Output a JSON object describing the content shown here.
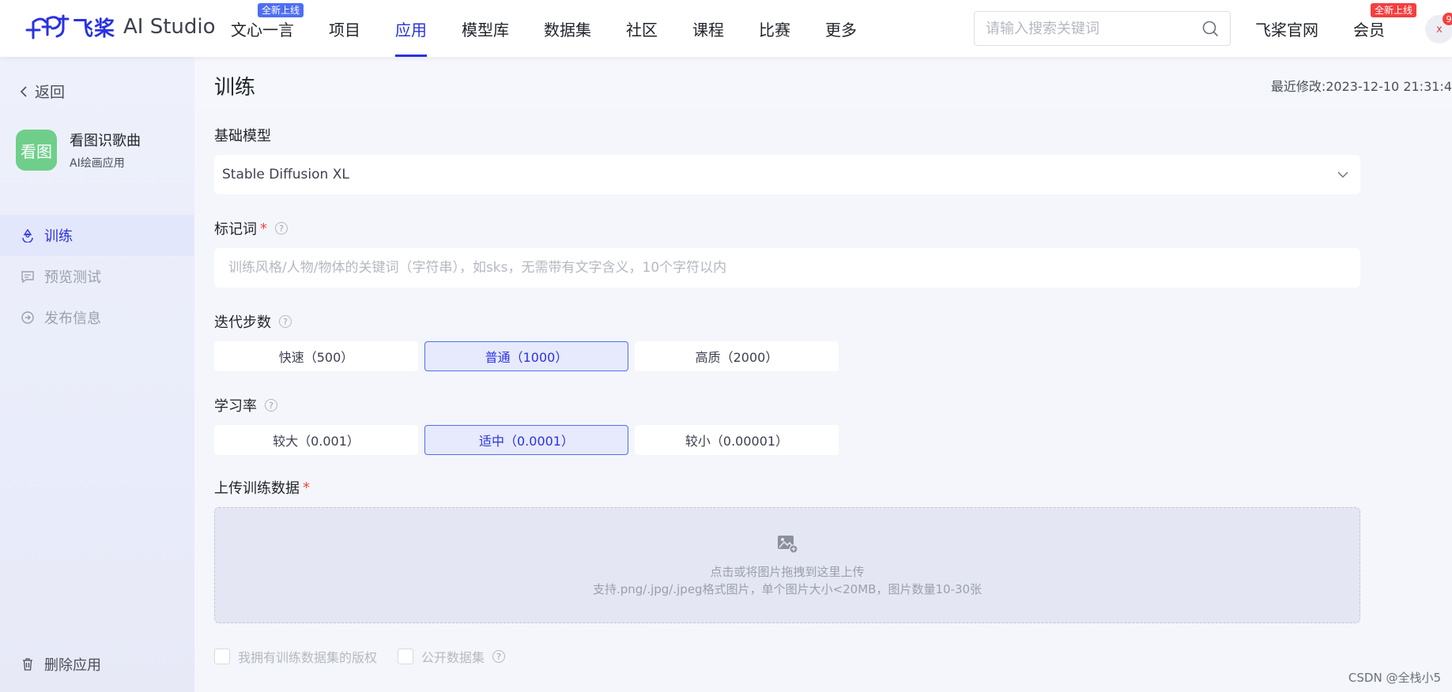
{
  "nav": {
    "brand_cn": "飞桨",
    "brand_en": "AI Studio",
    "items": [
      {
        "label": "文心一言",
        "badge": "全新上线"
      },
      {
        "label": "项目"
      },
      {
        "label": "应用"
      },
      {
        "label": "模型库"
      },
      {
        "label": "数据集"
      },
      {
        "label": "社区"
      },
      {
        "label": "课程"
      },
      {
        "label": "比赛"
      },
      {
        "label": "更多"
      }
    ],
    "active": "应用",
    "search_placeholder": "请输入搜索关键词",
    "official_site": "飞桨官网",
    "member": "会员",
    "member_badge": "全新上线",
    "avatar_text": "x",
    "notification_count": "9"
  },
  "sidebar": {
    "back_label": "返回",
    "app_icon_text": "看图",
    "app_name": "看图识歌曲",
    "app_type": "AI绘画应用",
    "items": [
      {
        "label": "训练",
        "icon": "recycle-icon",
        "active": true
      },
      {
        "label": "预览测试",
        "icon": "chat-icon",
        "active": false
      },
      {
        "label": "发布信息",
        "icon": "arrow-circle-icon",
        "active": false
      }
    ],
    "delete_label": "删除应用"
  },
  "main": {
    "title": "训练",
    "last_modified_label": "最近修改:",
    "last_modified_value": "2023-12-10 21:31:4",
    "base_model": {
      "label": "基础模型",
      "value": "Stable Diffusion XL"
    },
    "tag_word": {
      "label": "标记词",
      "required": "*",
      "placeholder": "训练风格/人物/物体的关键词（字符串），如sks，无需带有文字含义，10个字符以内"
    },
    "iterations": {
      "label": "迭代步数",
      "options": [
        "快速（500）",
        "普通（1000）",
        "高质（2000）"
      ],
      "selected": "普通（1000）"
    },
    "learning_rate": {
      "label": "学习率",
      "options": [
        "较大（0.001）",
        "适中（0.0001）",
        "较小（0.00001）"
      ],
      "selected": "适中（0.0001）"
    },
    "upload": {
      "label": "上传训练数据",
      "required": "*",
      "line1": "点击或将图片拖拽到这里上传",
      "line2": "支持.png/.jpg/.jpeg格式图片，单个图片大小<20MB，图片数量10-30张"
    },
    "checkboxes": {
      "copyright": "我拥有训练数据集的版权",
      "public": "公开数据集"
    }
  },
  "watermark": "CSDN @全栈小5",
  "colors": {
    "accent": "#2932e1",
    "accent_light": "#4e6ef2",
    "required": "#f53f3f",
    "app_icon_bg": "#6fcf8a"
  }
}
